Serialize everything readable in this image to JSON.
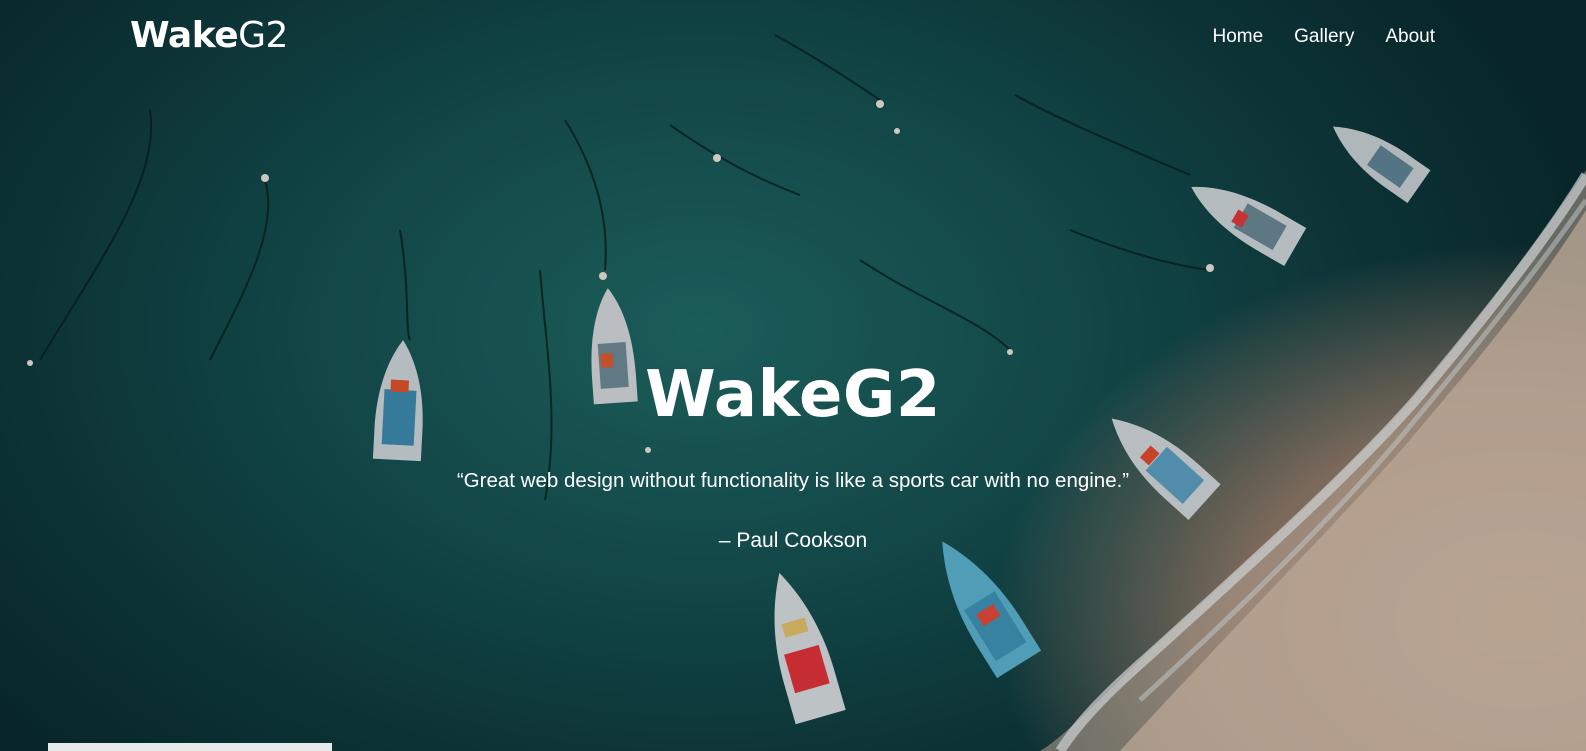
{
  "header": {
    "brand_bold": "Wake",
    "brand_regular": "G2",
    "nav": [
      {
        "label": "Home"
      },
      {
        "label": "Gallery"
      },
      {
        "label": "About"
      }
    ]
  },
  "hero": {
    "title": "WakeG2",
    "quote": "“Great web design without functionality is like a sports car with no engine.”",
    "author": "– Paul Cookson"
  }
}
